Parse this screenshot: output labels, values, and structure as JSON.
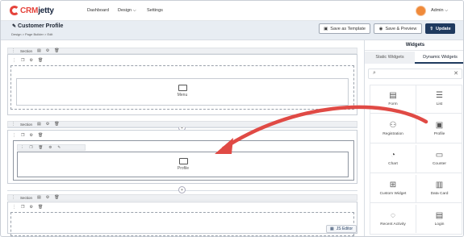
{
  "nav": {
    "logo_crm": "CRM",
    "logo_jetty": "jetty",
    "dashboard": "Dashboard",
    "design": "Design",
    "settings": "Settings",
    "user": "Admin"
  },
  "header": {
    "title": "Customer Profile",
    "breadcrumb": "Design  >  Page Builder  >  Edit",
    "save_template": "Save as Template",
    "save_preview": "Save & Preview",
    "update": "Update"
  },
  "canvas": {
    "section1": {
      "label": "Section",
      "widget": "Menu"
    },
    "section2": {
      "label": "Section",
      "widget": "Profile"
    },
    "section3": {
      "label": "Section"
    },
    "js_editor": "JS Editor"
  },
  "panel": {
    "title": "Widgets",
    "tab_static": "Static Widgets",
    "tab_dynamic": "Dynamic Widgets",
    "widgets": [
      "Form",
      "List",
      "Registration",
      "Profile",
      "Chart",
      "Counter",
      "Custom Widget",
      "Data Card",
      "Recent Activity",
      "Login"
    ]
  },
  "colors": {
    "brand_red": "#e5433b",
    "primary_navy": "#1f3a5f",
    "arrow": "#e04a45"
  }
}
